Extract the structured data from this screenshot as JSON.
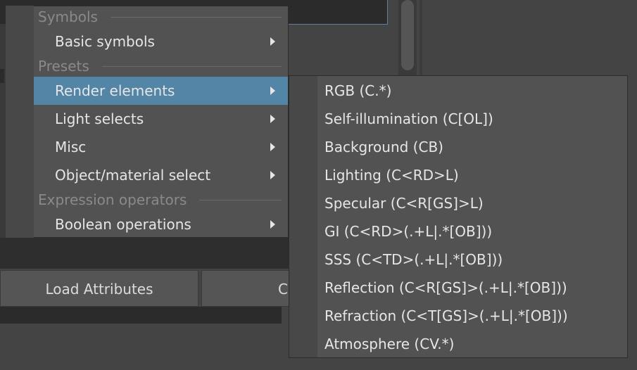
{
  "background": {
    "load_attributes_label": "Load Attributes",
    "second_button_label": "C"
  },
  "menu": {
    "sections": [
      {
        "label": "Symbols"
      },
      {
        "label": "Presets"
      },
      {
        "label": "Expression operators"
      }
    ],
    "items": [
      {
        "label": "Basic symbols",
        "has_submenu": true
      },
      {
        "label": "Render elements",
        "has_submenu": true,
        "active": true
      },
      {
        "label": "Light selects",
        "has_submenu": true
      },
      {
        "label": "Misc",
        "has_submenu": true
      },
      {
        "label": "Object/material select",
        "has_submenu": true
      },
      {
        "label": "Boolean operations",
        "has_submenu": true
      }
    ]
  },
  "submenu": {
    "items": [
      {
        "label": "RGB (C.*)"
      },
      {
        "label": "Self-illumination (C[OL])"
      },
      {
        "label": "Background (CB)"
      },
      {
        "label": "Lighting (C<RD>L)"
      },
      {
        "label": "Specular (C<R[GS]>L)"
      },
      {
        "label": "GI (C<RD>(.+L|.*[OB]))"
      },
      {
        "label": "SSS (C<TD>(.+L|.*[OB]))"
      },
      {
        "label": "Reflection (C<R[GS]>(.+L|.*[OB]))"
      },
      {
        "label": "Refraction (C<T[GS]>(.+L|.*[OB]))"
      },
      {
        "label": "Atmosphere (CV.*)"
      }
    ]
  },
  "colors": {
    "highlight": "#5285a6",
    "menu_bg": "#525252",
    "section_text": "#8a8a8a"
  }
}
